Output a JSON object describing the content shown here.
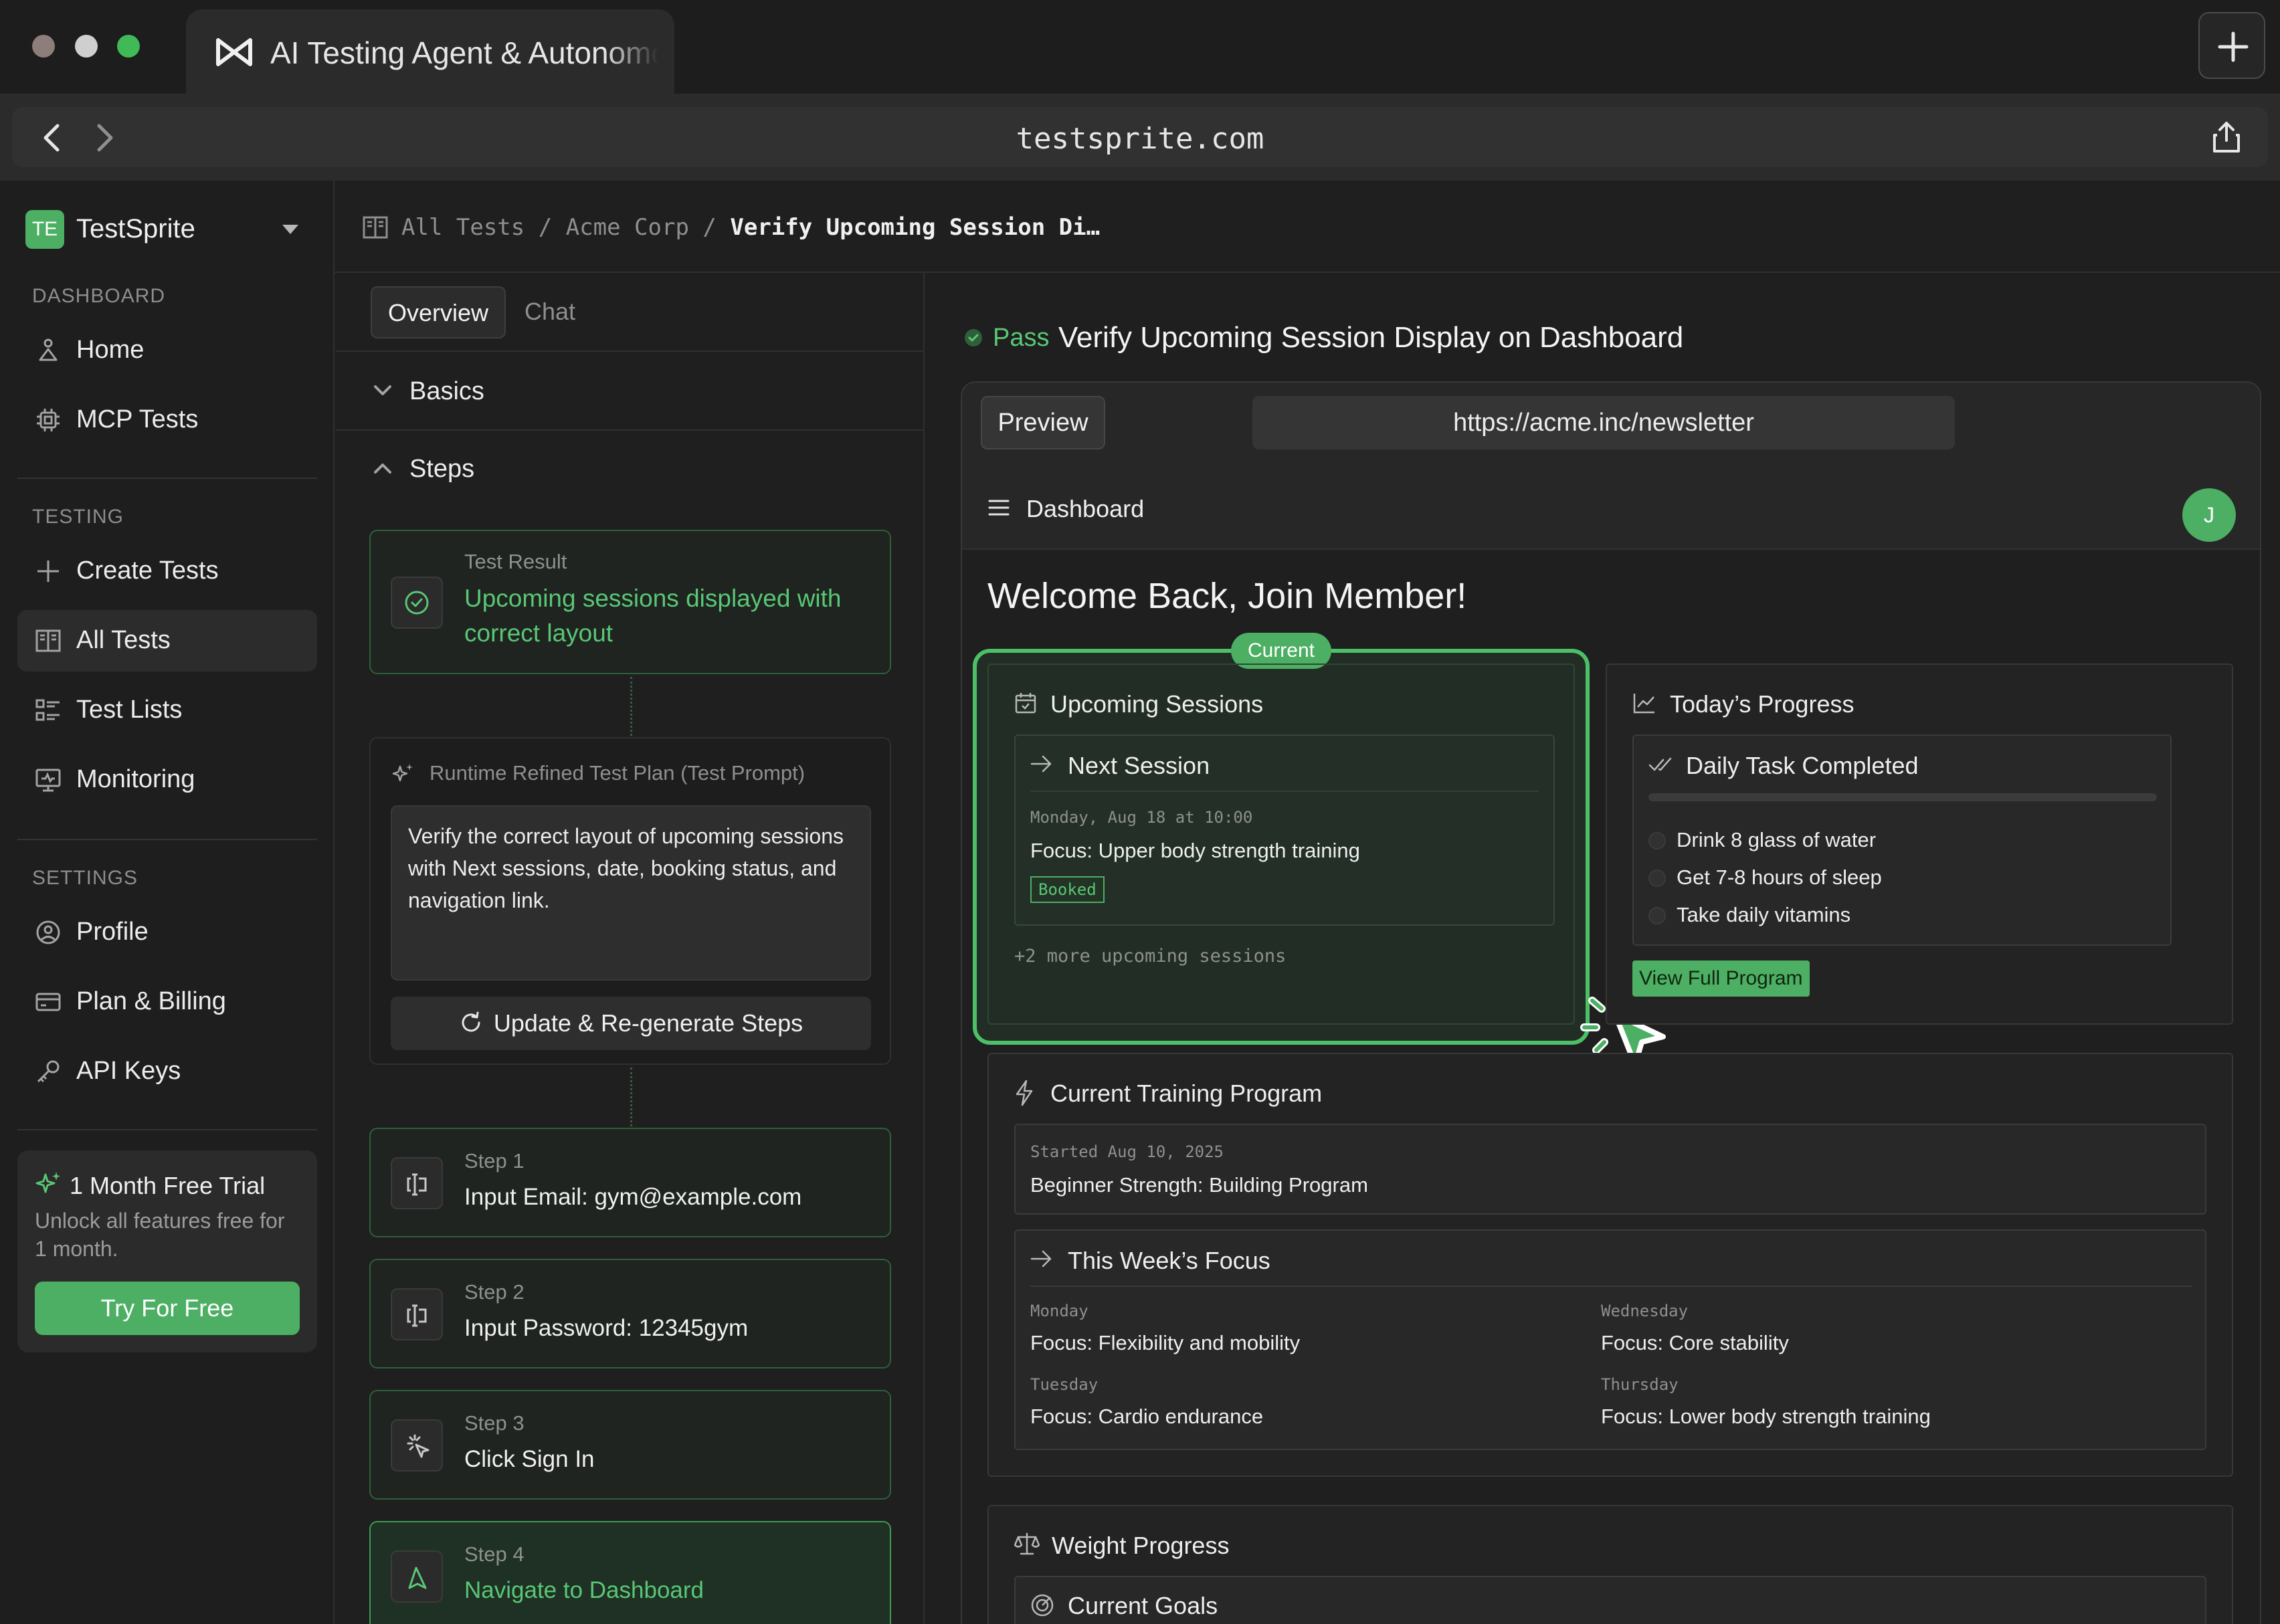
{
  "browser": {
    "tab_title": "AI Testing Agent & Autonomous",
    "url": "testsprite.com",
    "traffic_colors": [
      "#8d7d7b",
      "#cfcfcf",
      "#3fba56"
    ]
  },
  "workspace": {
    "badge": "TE",
    "name": "TestSprite"
  },
  "sidebar": {
    "sections": {
      "dashboard": "DASHBOARD",
      "testing": "TESTING",
      "settings": "SETTINGS"
    },
    "items": [
      {
        "label": "Home",
        "icon": "home-icon"
      },
      {
        "label": "MCP Tests",
        "icon": "chip-icon"
      },
      {
        "label": "Create Tests",
        "icon": "plus-icon"
      },
      {
        "label": "All Tests",
        "icon": "book-icon"
      },
      {
        "label": "Test Lists",
        "icon": "list-icon"
      },
      {
        "label": "Monitoring",
        "icon": "monitor-icon"
      },
      {
        "label": "Profile",
        "icon": "user-icon"
      },
      {
        "label": "Plan & Billing",
        "icon": "card-icon"
      },
      {
        "label": "API Keys",
        "icon": "key-icon"
      }
    ],
    "trial": {
      "title": "1 Month Free Trial",
      "desc": "Unlock all features free for 1 month.",
      "button": "Try For Free"
    }
  },
  "breadcrumb": {
    "root": "All Tests",
    "sep": "/",
    "org": "Acme Corp",
    "current": "Verify Upcoming Session Di…"
  },
  "left": {
    "tabs": [
      "Overview",
      "Chat"
    ],
    "basics": "Basics",
    "steps": "Steps",
    "result": {
      "kicker": "Test Result",
      "text_line1": "Upcoming sessions displayed with",
      "text_line2": "correct layout"
    },
    "plan": {
      "kicker": "Runtime Refined Test Plan (Test Prompt)",
      "text": "Verify the correct layout of upcoming sessions with Next sessions, date, booking status, and navigation link.",
      "button": "Update & Re-generate Steps"
    },
    "step_items": [
      {
        "kicker": "Step 1",
        "text": "Input Email: gym@example.com"
      },
      {
        "kicker": "Step 2",
        "text": "Input Password: 12345gym"
      },
      {
        "kicker": "Step 3",
        "text": "Click Sign In"
      },
      {
        "kicker": "Step 4",
        "text": "Navigate to Dashboard"
      }
    ]
  },
  "right": {
    "status": "Pass",
    "title": "Verify Upcoming Session Display on Dashboard",
    "preview_button": "Preview",
    "preview_url": "https://acme.inc/newsletter",
    "app": {
      "header": "Dashboard",
      "avatar": "J",
      "welcome": "Welcome Back, Join Member!",
      "current_badge": "Current",
      "upcoming": {
        "title": "Upcoming Sessions",
        "next_title": "Next Session",
        "date": "Monday, Aug 18 at 10:00",
        "focus": "Focus: Upper body strength training",
        "status": "Booked",
        "more": "+2 more upcoming sessions"
      },
      "progress": {
        "title": "Today’s Progress",
        "task_title": "Daily Task Completed",
        "progress_fraction": 0,
        "tasks": [
          "Drink 8 glass of water",
          "Get 7-8 hours of sleep",
          "Take daily vitamins"
        ],
        "button": "View Full Program"
      },
      "training": {
        "title": "Current Training Program",
        "started": "Started Aug 10, 2025",
        "name": "Beginner Strength: Building Program",
        "week_title": "This Week’s Focus",
        "days": [
          {
            "day": "Monday",
            "focus": "Focus: Flexibility and mobility"
          },
          {
            "day": "Wednesday",
            "focus": "Focus: Core stability"
          },
          {
            "day": "Tuesday",
            "focus": "Focus: Cardio endurance"
          },
          {
            "day": "Thursday",
            "focus": "Focus: Lower body strength training"
          }
        ]
      },
      "weight": {
        "title": "Weight Progress",
        "goals": "Current Goals"
      }
    }
  },
  "colors": {
    "accent": "#4caf63",
    "accent_text": "#59c775",
    "bg": "#1e1f1e"
  }
}
